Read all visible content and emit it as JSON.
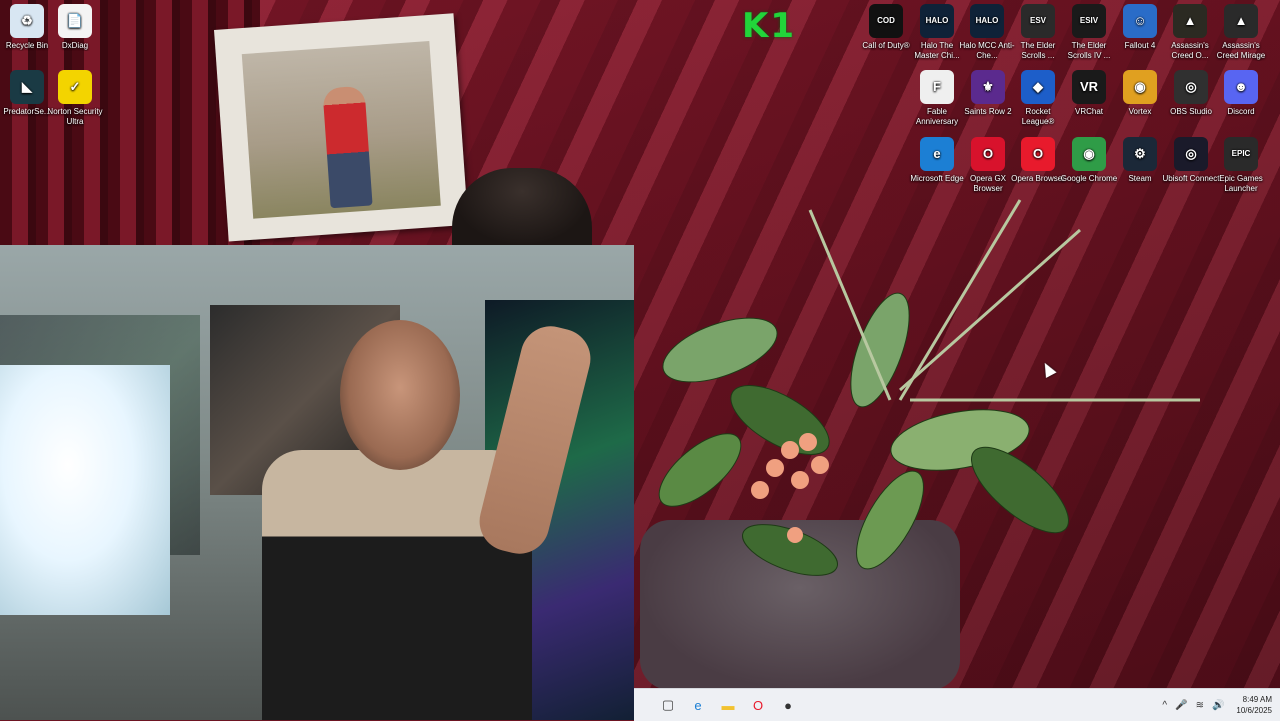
{
  "desktop": {
    "left_icons": [
      {
        "label": "Recycle Bin",
        "icon": "recycle-bin-icon",
        "glyph": "♻",
        "color": "#d8e6f2"
      },
      {
        "label": "DxDiag",
        "icon": "document-icon",
        "glyph": "📄",
        "color": "#f4f4f4"
      },
      {
        "label": "PredatorSe...",
        "icon": "predatorsense-icon",
        "glyph": "◣",
        "color": "#1a3a44"
      },
      {
        "label": "Norton Security Ultra",
        "icon": "norton-icon",
        "glyph": "✓",
        "color": "#f3d400"
      }
    ],
    "right_icons": [
      {
        "label": "Call of Duty®",
        "icon": "call-of-duty-icon",
        "glyph": "COD",
        "color": "#111111"
      },
      {
        "label": "Halo The Master Chi...",
        "icon": "halo-mcc-icon",
        "glyph": "HALO",
        "color": "#0f2238"
      },
      {
        "label": "Halo MCC Anti-Che...",
        "icon": "halo-anticheat-icon",
        "glyph": "HALO",
        "color": "#0f2238"
      },
      {
        "label": "The Elder Scrolls ...",
        "icon": "skyrim-icon",
        "glyph": "ESV",
        "color": "#2a2a2a"
      },
      {
        "label": "The Elder Scrolls IV ...",
        "icon": "oblivion-icon",
        "glyph": "ESIV",
        "color": "#1a1a1a"
      },
      {
        "label": "Fallout 4",
        "icon": "fallout4-icon",
        "glyph": "☺",
        "color": "#2a6cc8"
      },
      {
        "label": "Assassin's Creed O...",
        "icon": "ac-origins-icon",
        "glyph": "▲",
        "color": "#2b2a22"
      },
      {
        "label": "Assassin's Creed Mirage",
        "icon": "ac-mirage-icon",
        "glyph": "▲",
        "color": "#2a2a2a"
      },
      {
        "label": "Fable Anniversary",
        "icon": "fable-icon",
        "glyph": "F",
        "color": "#efefef"
      },
      {
        "label": "Saints Row 2",
        "icon": "saints-row-icon",
        "glyph": "⚜",
        "color": "#5b2a8e"
      },
      {
        "label": "Rocket League®",
        "icon": "rocket-league-icon",
        "glyph": "◆",
        "color": "#1d5ec9"
      },
      {
        "label": "VRChat",
        "icon": "vrchat-icon",
        "glyph": "VR",
        "color": "#1a1a1a"
      },
      {
        "label": "Vortex",
        "icon": "vortex-icon",
        "glyph": "◉",
        "color": "#e0a020"
      },
      {
        "label": "OBS Studio",
        "icon": "obs-icon",
        "glyph": "◎",
        "color": "#303030"
      },
      {
        "label": "Discord",
        "icon": "discord-icon",
        "glyph": "☻",
        "color": "#5865f2"
      },
      {
        "label": "Microsoft Edge",
        "icon": "edge-icon",
        "glyph": "e",
        "color": "#1c7fd4"
      },
      {
        "label": "Opera GX Browser",
        "icon": "opera-gx-icon",
        "glyph": "O",
        "color": "#d8122c"
      },
      {
        "label": "Opera Browser",
        "icon": "opera-icon",
        "glyph": "O",
        "color": "#e81a2c"
      },
      {
        "label": "Google Chrome",
        "icon": "chrome-icon",
        "glyph": "◉",
        "color": "#2f9c47"
      },
      {
        "label": "Steam",
        "icon": "steam-icon",
        "glyph": "⚙",
        "color": "#1b2838"
      },
      {
        "label": "Ubisoft Connect",
        "icon": "ubisoft-icon",
        "glyph": "◎",
        "color": "#1a1a2a"
      },
      {
        "label": "Epic Games Launcher",
        "icon": "epic-games-icon",
        "glyph": "EPIC",
        "color": "#2a2a2a"
      }
    ],
    "overlay_text": "K1"
  },
  "taskbar": {
    "apps": [
      {
        "name": "task-view-button",
        "icon": "task-view-icon",
        "glyph": "▢",
        "color": "#444444"
      },
      {
        "name": "edge-taskbar-button",
        "icon": "edge-icon",
        "glyph": "e",
        "color": "#1c7fd4"
      },
      {
        "name": "file-explorer-button",
        "icon": "folder-icon",
        "glyph": "▬",
        "color": "#f2c230"
      },
      {
        "name": "opera-taskbar-button",
        "icon": "opera-icon",
        "glyph": "O",
        "color": "#e81a2c"
      },
      {
        "name": "app-taskbar-button",
        "icon": "app-icon",
        "glyph": "●",
        "color": "#333333"
      }
    ],
    "tray": {
      "chevron": "^",
      "time": "8:49 AM",
      "date": "10/6/2025"
    }
  }
}
